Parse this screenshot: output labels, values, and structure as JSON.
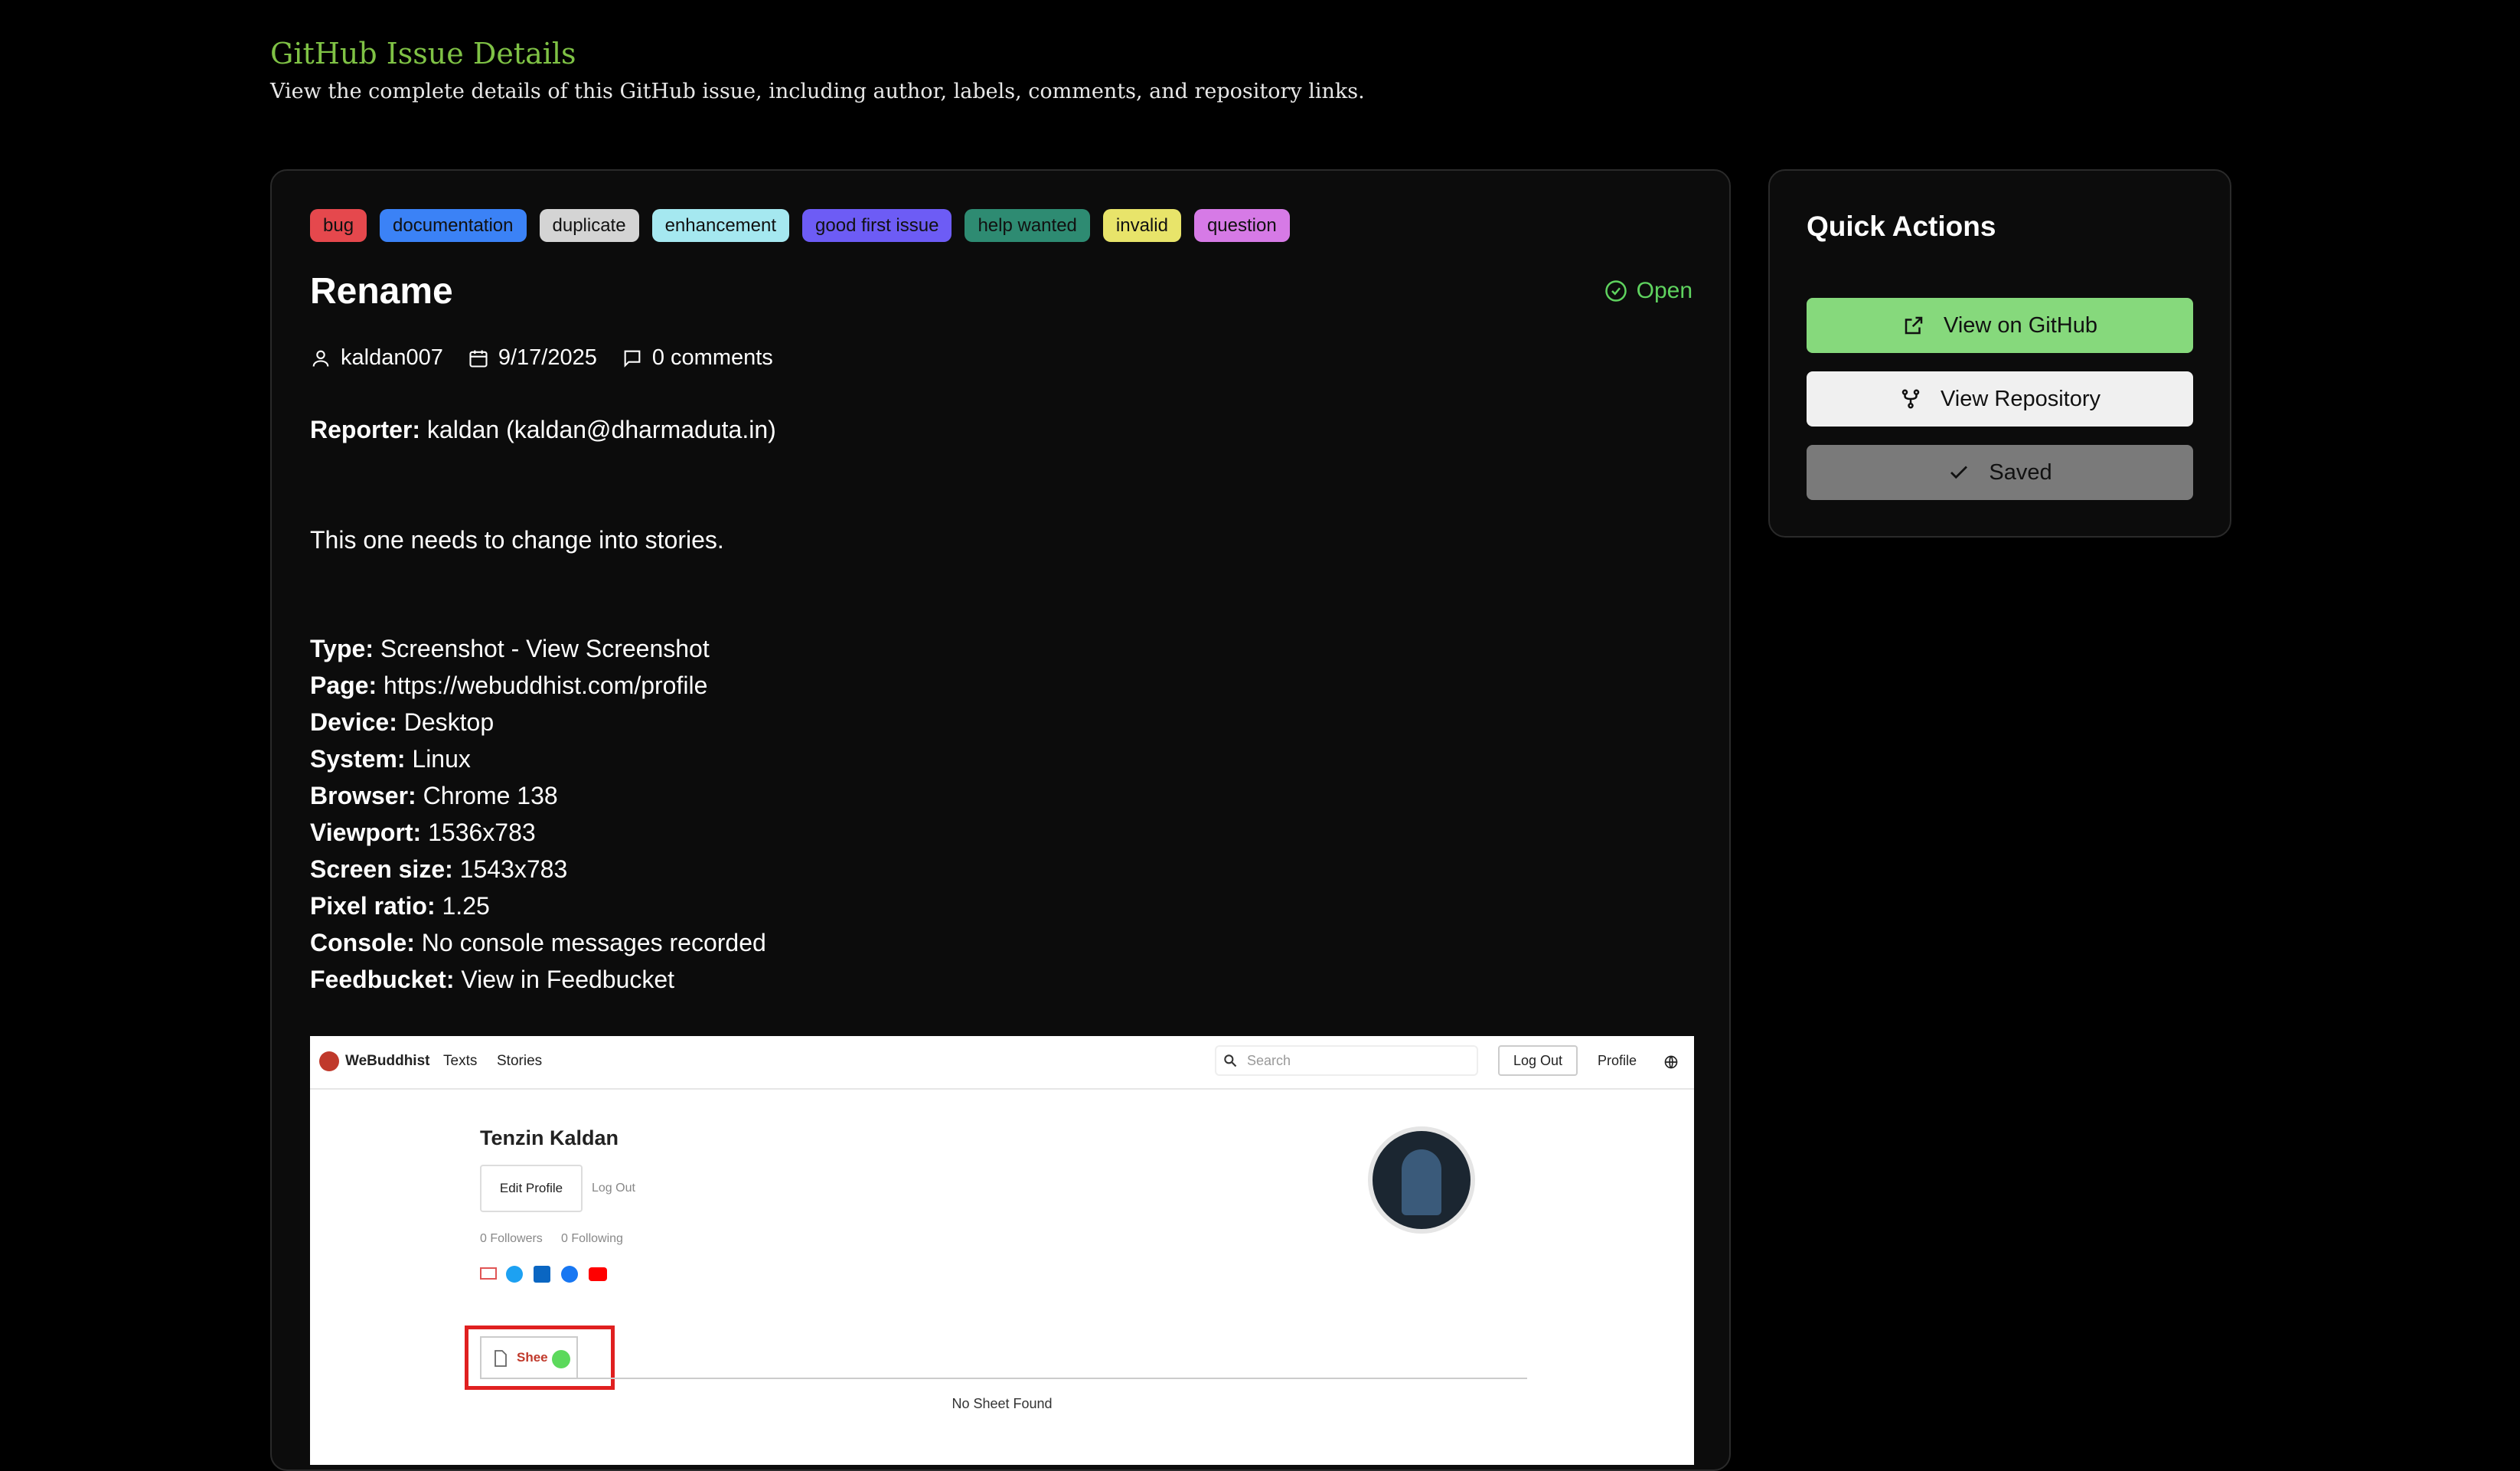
{
  "header": {
    "title": "GitHub Issue Details",
    "subtitle": "View the complete details of this GitHub issue, including author, labels, comments, and repository links."
  },
  "issue": {
    "labels": [
      {
        "text": "bug",
        "color": "#e5484d"
      },
      {
        "text": "documentation",
        "color": "#3b82f6"
      },
      {
        "text": "duplicate",
        "color": "#d4d4d4"
      },
      {
        "text": "enhancement",
        "color": "#a5e8f0"
      },
      {
        "text": "good first issue",
        "color": "#6d5cf5"
      },
      {
        "text": "help wanted",
        "color": "#2e8b72"
      },
      {
        "text": "invalid",
        "color": "#e8e46a"
      },
      {
        "text": "question",
        "color": "#d67ae6"
      }
    ],
    "title": "Rename",
    "status": "Open",
    "author": "kaldan007",
    "date": "9/17/2025",
    "comments": "0 comments",
    "reporter_label": "Reporter:",
    "reporter_value": "kaldan (kaldan@dharmaduta.in)",
    "description": "This one needs to change into stories.",
    "fields": [
      {
        "label": "Type:",
        "value": "Screenshot - View Screenshot"
      },
      {
        "label": "Page:",
        "value": "https://webuddhist.com/profile"
      },
      {
        "label": "Device:",
        "value": "Desktop"
      },
      {
        "label": "System:",
        "value": "Linux"
      },
      {
        "label": "Browser:",
        "value": "Chrome 138"
      },
      {
        "label": "Viewport:",
        "value": "1536x783"
      },
      {
        "label": "Screen size:",
        "value": "1543x783"
      },
      {
        "label": "Pixel ratio:",
        "value": "1.25"
      },
      {
        "label": "Console:",
        "value": "No console messages recorded"
      },
      {
        "label": "Feedbucket:",
        "value": "View in Feedbucket"
      }
    ]
  },
  "screenshot": {
    "brand": "WeBuddhist",
    "nav": [
      "Texts",
      "Stories"
    ],
    "search_placeholder": "Search",
    "logout_button": "Log Out",
    "profile_link": "Profile",
    "name": "Tenzin Kaldan",
    "edit_profile": "Edit Profile",
    "logout_link": "Log Out",
    "followers": "0 Followers",
    "following": "0 Following",
    "tab_label": "Shee",
    "empty_text": "No Sheet Found"
  },
  "quick_actions": {
    "title": "Quick Actions",
    "view_github": "View on GitHub",
    "view_repo": "View Repository",
    "saved": "Saved"
  }
}
